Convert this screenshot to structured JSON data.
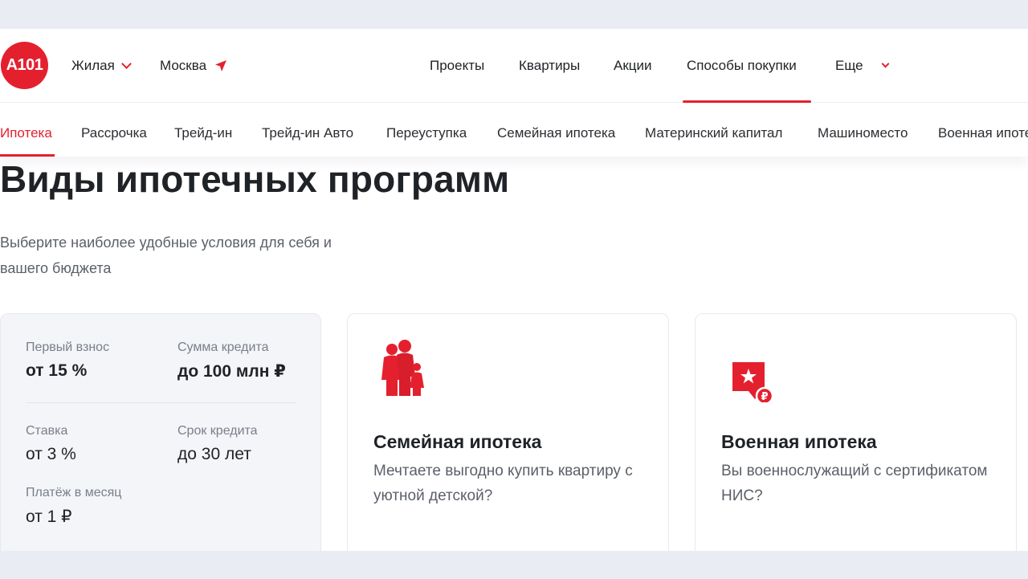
{
  "header": {
    "logo_text": "А101",
    "segment": "Жилая",
    "city": "Москва",
    "nav": [
      "Проекты",
      "Квартиры",
      "Акции",
      "Способы покупки",
      "Еще"
    ],
    "active_nav": "Способы покупки"
  },
  "subnav": {
    "items": [
      "Ипотека",
      "Рассрочка",
      "Трейд-ин",
      "Трейд-ин Авто",
      "Переуступка",
      "Семейная ипотека",
      "Материнский капитал",
      "Машиноместо",
      "Военная ипотека"
    ],
    "active": "Ипотека"
  },
  "main": {
    "title": "Виды ипотечных программ",
    "subtitle": "Выберите наиболее удобные условия для себя и вашего бюджета"
  },
  "summary": {
    "down_payment_label": "Первый взнос",
    "down_payment_value": "от 15 %",
    "loan_amount_label": "Сумма кредита",
    "loan_amount_value": "до 100 млн ₽",
    "rate_label": "Ставка",
    "rate_value": "от 3 %",
    "term_label": "Срок кредита",
    "term_value": "до 30 лет",
    "payment_label": "Платёж в месяц",
    "payment_value": "от 1 ₽"
  },
  "programs": [
    {
      "title": "Семейная ипотека",
      "description": "Мечтаете выгодно купить квартиру с уютной детской?",
      "icon": "family-icon"
    },
    {
      "title": "Военная ипотека",
      "description": "Вы военнослужащий с сертификатом НИС?",
      "icon": "military-badge-icon"
    }
  ],
  "colors": {
    "accent": "#e4202f",
    "background": "#e9ecf3",
    "card": "#f3f5f9"
  }
}
